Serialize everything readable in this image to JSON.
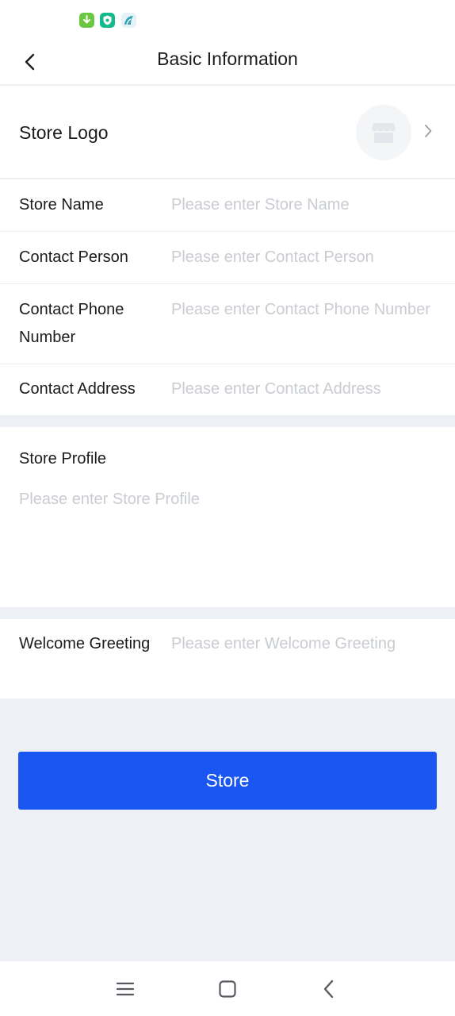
{
  "status_bar": {
    "icons": [
      "download-app-icon",
      "shield-app-icon",
      "bird-app-icon"
    ]
  },
  "header": {
    "title": "Basic Information",
    "back_icon": "chevron-left-icon"
  },
  "logo_row": {
    "label": "Store Logo",
    "avatar_icon": "store-icon",
    "chevron_icon": "chevron-right-icon"
  },
  "fields": [
    {
      "label": "Store Name",
      "placeholder": "Please enter Store Name",
      "value": ""
    },
    {
      "label": "Contact Person",
      "placeholder": "Please enter Contact Person",
      "value": ""
    },
    {
      "label": "Contact Phone Number",
      "placeholder": "Please enter Contact Phone Number",
      "value": ""
    },
    {
      "label": "Contact Address",
      "placeholder": "Please enter Contact Address",
      "value": ""
    }
  ],
  "profile": {
    "label": "Store Profile",
    "placeholder": "Please enter Store Profile",
    "value": ""
  },
  "welcome": {
    "label": "Welcome Greeting",
    "placeholder": "Please enter Welcome Greeting",
    "value": ""
  },
  "submit": {
    "label": "Store",
    "color": "#1a57f2"
  },
  "system_nav": {
    "icons": [
      "menu-icon",
      "home-icon",
      "back-icon"
    ]
  }
}
